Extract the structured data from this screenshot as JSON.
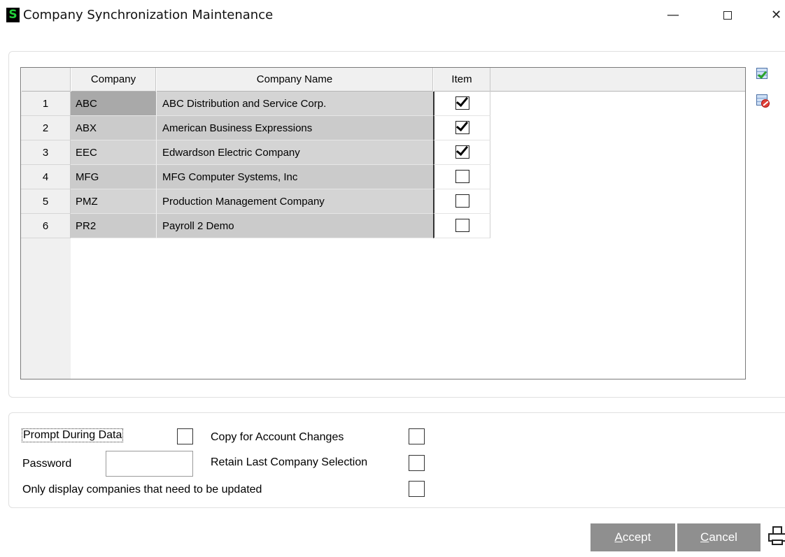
{
  "window": {
    "app_icon_glyph": "S",
    "title": "Company Synchronization Maintenance",
    "minimize_glyph": "—",
    "close_glyph": "✕"
  },
  "grid": {
    "headers": {
      "company": "Company",
      "company_name": "Company Name",
      "item": "Item"
    },
    "rows": [
      {
        "num": "1",
        "company": "ABC",
        "name": "ABC Distribution and Service Corp.",
        "item": true
      },
      {
        "num": "2",
        "company": "ABX",
        "name": "American Business Expressions",
        "item": true
      },
      {
        "num": "3",
        "company": "EEC",
        "name": "Edwardson Electric Company",
        "item": true
      },
      {
        "num": "4",
        "company": "MFG",
        "name": "MFG Computer Systems, Inc",
        "item": false
      },
      {
        "num": "5",
        "company": "PMZ",
        "name": "Production Management Company",
        "item": false
      },
      {
        "num": "6",
        "company": "PR2",
        "name": "Payroll 2 Demo",
        "item": false
      }
    ],
    "side_icons": [
      "select-all-icon",
      "clear-all-icon"
    ]
  },
  "options": {
    "prompt_during_data": {
      "label": "Prompt During Data",
      "checked": false
    },
    "copy_for_account_changes": {
      "label": "Copy for Account Changes",
      "checked": false
    },
    "password": {
      "label": "Password",
      "value": ""
    },
    "retain_last_company_selection": {
      "label": "Retain Last Company Selection",
      "checked": false
    },
    "only_display_companies": {
      "label": "Only display companies that need to be updated",
      "checked": false
    }
  },
  "buttons": {
    "accept": {
      "mnemonic": "A",
      "rest": "ccept"
    },
    "cancel": {
      "mnemonic": "C",
      "rest": "ancel"
    },
    "print_icon": "printer-icon"
  }
}
